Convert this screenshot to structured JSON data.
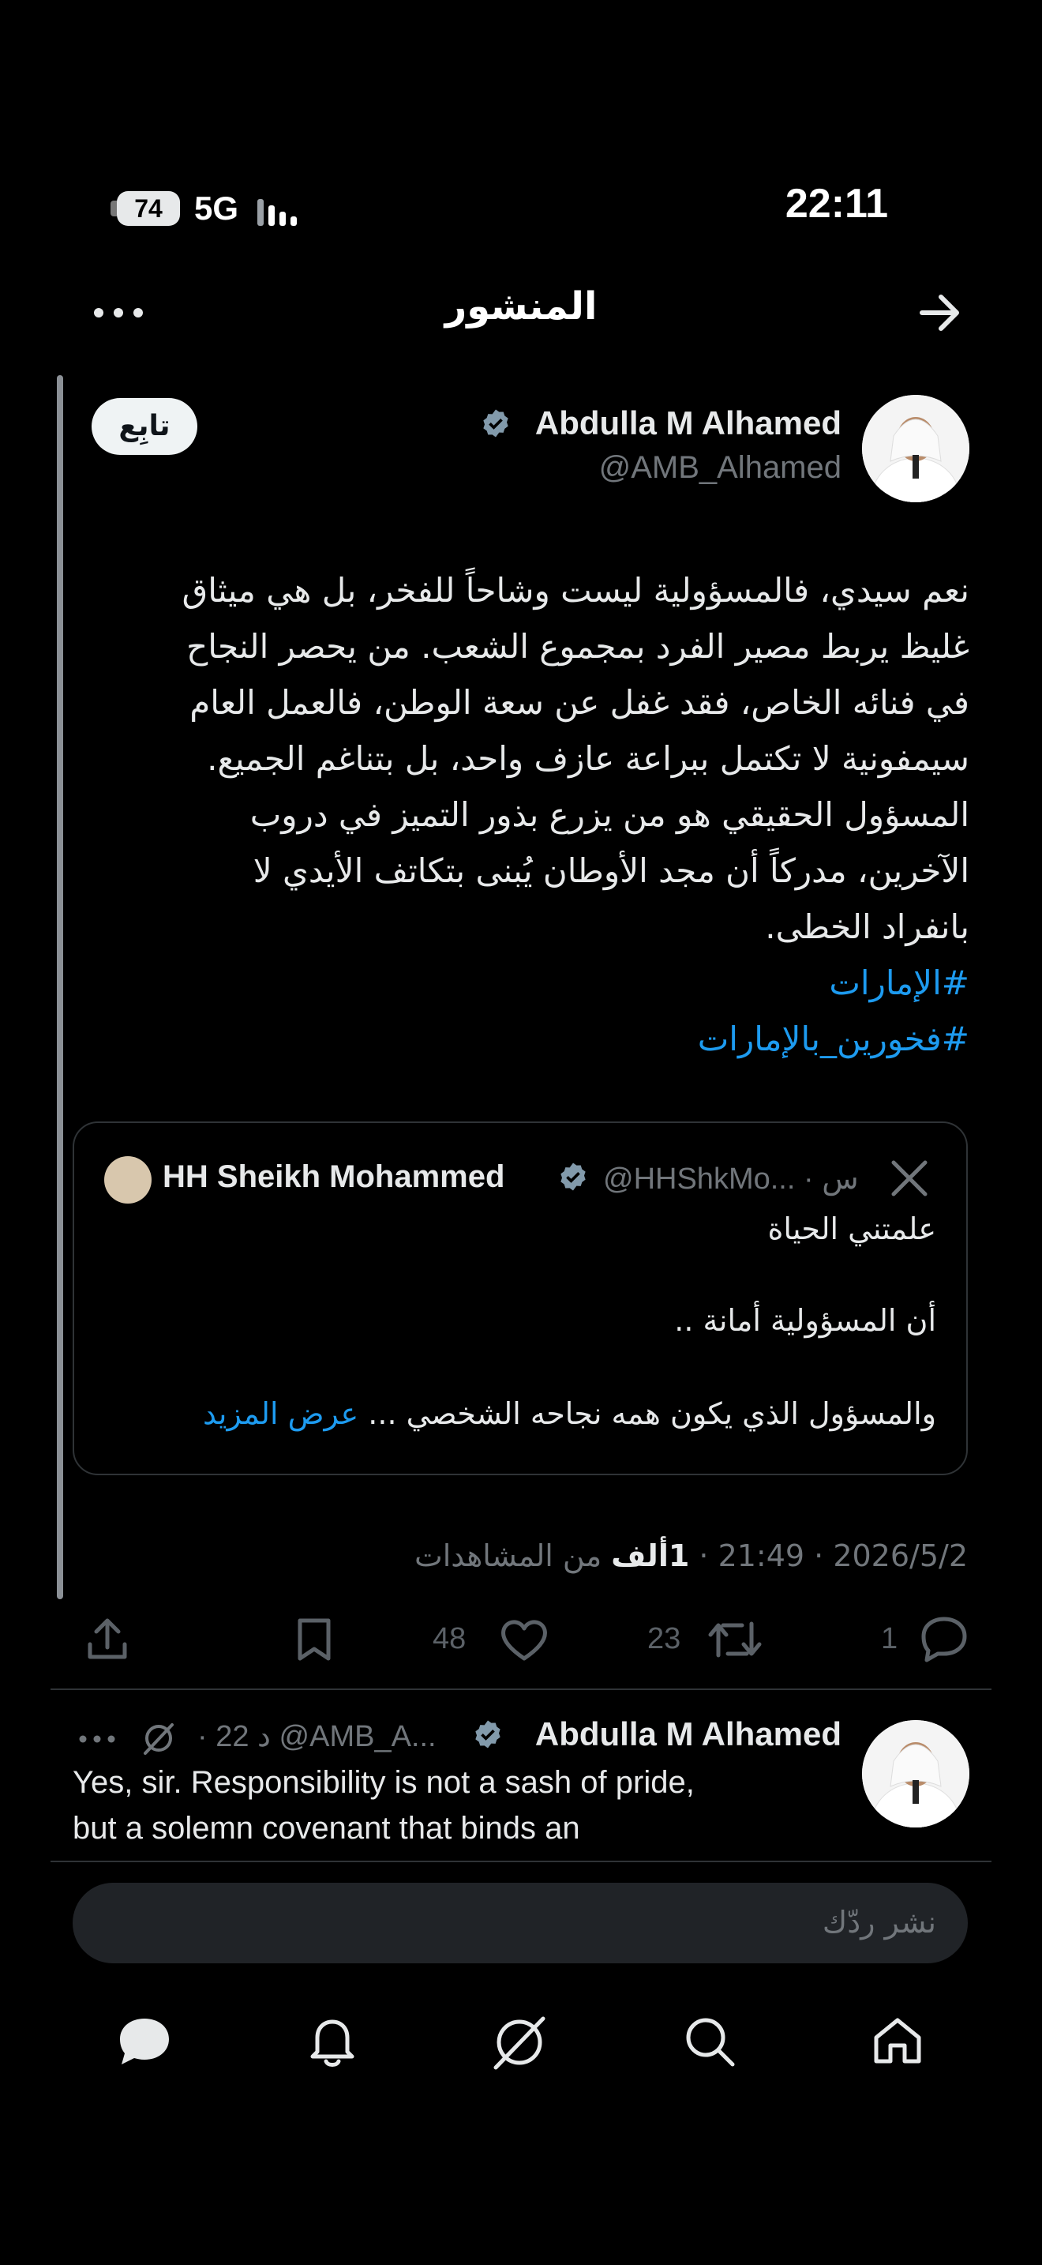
{
  "status_bar": {
    "battery": "74",
    "network": "5G",
    "time": "22:11"
  },
  "header": {
    "title": "المنشور"
  },
  "post": {
    "author_name": "Abdulla M Alhamed",
    "author_handle": "@AMB_Alhamed",
    "follow_label": "تابِع",
    "body_lines": [
      "نعم سيدي، فالمسؤولية ليست وشاحاً للفخر، بل هي ميثاق",
      "غليظ يربط مصير الفرد بمجموع الشعب. من يحصر النجاح",
      "في فنائه الخاص، فقد غفل عن سعة الوطن، فالعمل العام",
      "سيمفونية لا تكتمل ببراعة عازف واحد، بل بتناغم الجميع.",
      "المسؤول الحقيقي هو من يزرع بذور التميز في دروب",
      "الآخرين، مدركاً أن مجد الأوطان يُبنى بتكاتف الأيدي لا",
      "بانفراد الخطى."
    ],
    "hashtags": [
      "#الإمارات",
      "#فخورين_بالإمارات"
    ],
    "meta": {
      "date": "2026/5/2",
      "time": "21:49",
      "views_count": "1ألف",
      "views_label": "من المشاهدات"
    },
    "actions": {
      "replies": "1",
      "reposts": "23",
      "likes": "48"
    }
  },
  "quote": {
    "name": "HH Sheikh Mohammed",
    "handle": "@HHShkMo...",
    "time": "· س",
    "lines": [
      "علمتني الحياة",
      "أن المسؤولية أمانة ..",
      "والمسؤول الذي يكون همه نجاحه الشخصي ..."
    ],
    "show_more": "عرض المزيد"
  },
  "reply": {
    "name": "Abdulla M Alhamed",
    "handle": "@AMB_A...",
    "time": "· 22 د",
    "text_lines": [
      "Yes, sir. Responsibility is not a sash of pride,",
      "but a solemn covenant that binds an"
    ]
  },
  "reply_input": {
    "placeholder": "نشر ردّك"
  },
  "colors": {
    "background": "#000000",
    "accent": "#1d9bf0",
    "muted": "#71767b"
  },
  "icons": [
    "back-arrow-icon",
    "more-icon",
    "verified-icon",
    "x-logo-icon",
    "share-icon",
    "bookmark-icon",
    "heart-icon",
    "repost-icon",
    "reply-icon",
    "grok-icon",
    "messages-icon",
    "notifications-icon",
    "search-icon",
    "home-icon"
  ]
}
